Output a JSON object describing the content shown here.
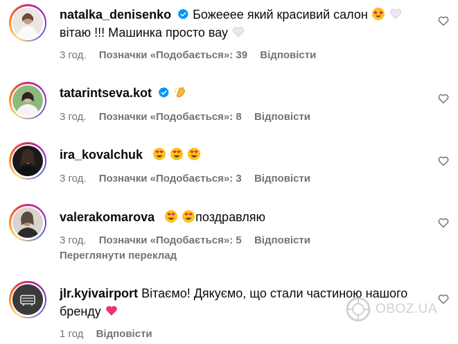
{
  "comments": [
    {
      "username": "natalka_denisenko",
      "verified": true,
      "line1": "Божееее який красивий салон",
      "line2": "вітаю !!! Машинка просто вау",
      "time": "3 год.",
      "likes": "Позначки «Подобається»: 39",
      "reply": "Відповісти",
      "emojis": [
        "star-struck",
        "white-heart",
        "white-heart"
      ]
    },
    {
      "username": "tatarintseva.kot",
      "verified": true,
      "line1": "",
      "time": "3 год.",
      "likes": "Позначки «Подобається»: 8",
      "reply": "Відповісти",
      "emojis": [
        "clapping-hands"
      ]
    },
    {
      "username": "ira_kovalchuk",
      "verified": false,
      "line1": "",
      "time": "3 год.",
      "likes": "Позначки «Подобається»: 3",
      "reply": "Відповісти",
      "emojis": [
        "heart-eyes",
        "heart-eyes",
        "heart-eyes"
      ]
    },
    {
      "username": "valerakomarova",
      "verified": false,
      "line1": "поздравляю",
      "time": "3 год.",
      "likes": "Позначки «Подобається»: 5",
      "reply": "Відповісти",
      "translate": "Переглянути переклад",
      "emojis": [
        "heart-eyes",
        "heart-eyes"
      ]
    },
    {
      "username": "jlr.kyivairport",
      "verified": false,
      "line1": "Вітаємо! Дякуємо, що стали частиною нашого",
      "line2": "бренду",
      "time": "1 год",
      "reply": "Відповісти",
      "emojis": [
        "pink-heart"
      ]
    }
  ],
  "watermark": "OBOZ.UA",
  "colors": {
    "text": "#0a0a0a",
    "meta": "#737373",
    "verified": "#0095f6",
    "heart_outline": "#737373"
  },
  "icons": [
    "heart-outline-icon",
    "verified-badge-icon"
  ]
}
